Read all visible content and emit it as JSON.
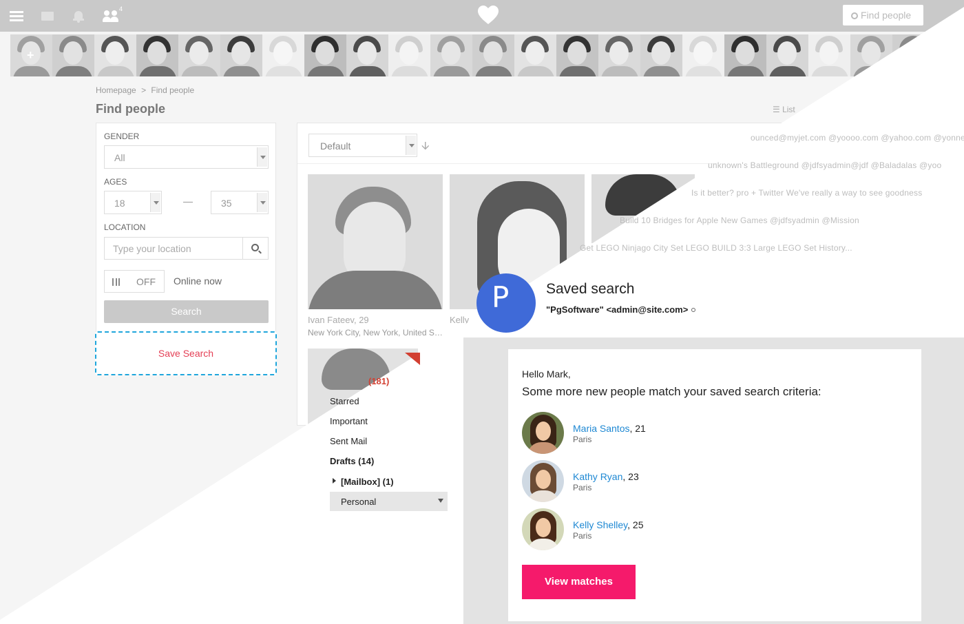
{
  "topbar": {
    "notification_count": "4",
    "find_people_label": "Find people"
  },
  "strip": {
    "add_label": "+"
  },
  "breadcrumb": {
    "home": "Homepage",
    "separator": ">",
    "current": "Find people"
  },
  "page": {
    "title": "Find people",
    "list_view_label": "List"
  },
  "filter": {
    "gender_label": "GENDER",
    "gender_value": "All",
    "ages_label": "AGES",
    "age_from": "18",
    "age_to": "35",
    "location_label": "LOCATION",
    "location_placeholder": "Type your location",
    "online_toggle": "OFF",
    "online_label": "Online now",
    "search_button": "Search",
    "save_search_button": "Save Search"
  },
  "results": {
    "sort_value": "Default",
    "cards": [
      {
        "name": "Ivan Fateev",
        "age": "29",
        "location": "New York City, New York, United States"
      },
      {
        "name": "Kelly"
      }
    ]
  },
  "mail_sidebar": {
    "inbox_count": "(181)",
    "starred": "Starred",
    "important": "Important",
    "sent": "Sent Mail",
    "drafts": "Drafts (14)",
    "mailbox": "[Mailbox] (1)",
    "personal": "Personal"
  },
  "ghost_lines": [
    "ounced@myjet.com  @yoooo.com  @yahoo.com  @yonne.com",
    "unknown's Battleground  @jdfsyadmin@jdf  @Baladalas  @yoo",
    "Is it better?  pro + Twitter  We've really a way to see  goodness",
    "Build 10 Bridges for Apple  New Games  @jdfsyadmin  @Mission",
    "Get LEGO Ninjago City Set LEGO BUILD 3:3 Large LEGO Set History..."
  ],
  "saved_search": {
    "avatar_letter": "P",
    "title": "Saved search",
    "from": "\"PgSoftware\" <admin@site.com>"
  },
  "email": {
    "greeting": "Hello Mark,",
    "lead": "Some more new people match your saved search criteria:",
    "matches": [
      {
        "name": "Maria Santos",
        "age": ", 21",
        "city": "Paris"
      },
      {
        "name": "Kathy Ryan",
        "age": ", 23",
        "city": "Paris"
      },
      {
        "name": "Kelly Shelley",
        "age": ", 25",
        "city": "Paris"
      }
    ],
    "cta": "View matches"
  },
  "colors": {
    "topbar": "#c9c9c9",
    "save_border": "#1ea6dc",
    "save_text": "#e43f55",
    "link": "#1e88d3",
    "cta": "#f51a6b",
    "avatar": "#3f6ad8"
  }
}
